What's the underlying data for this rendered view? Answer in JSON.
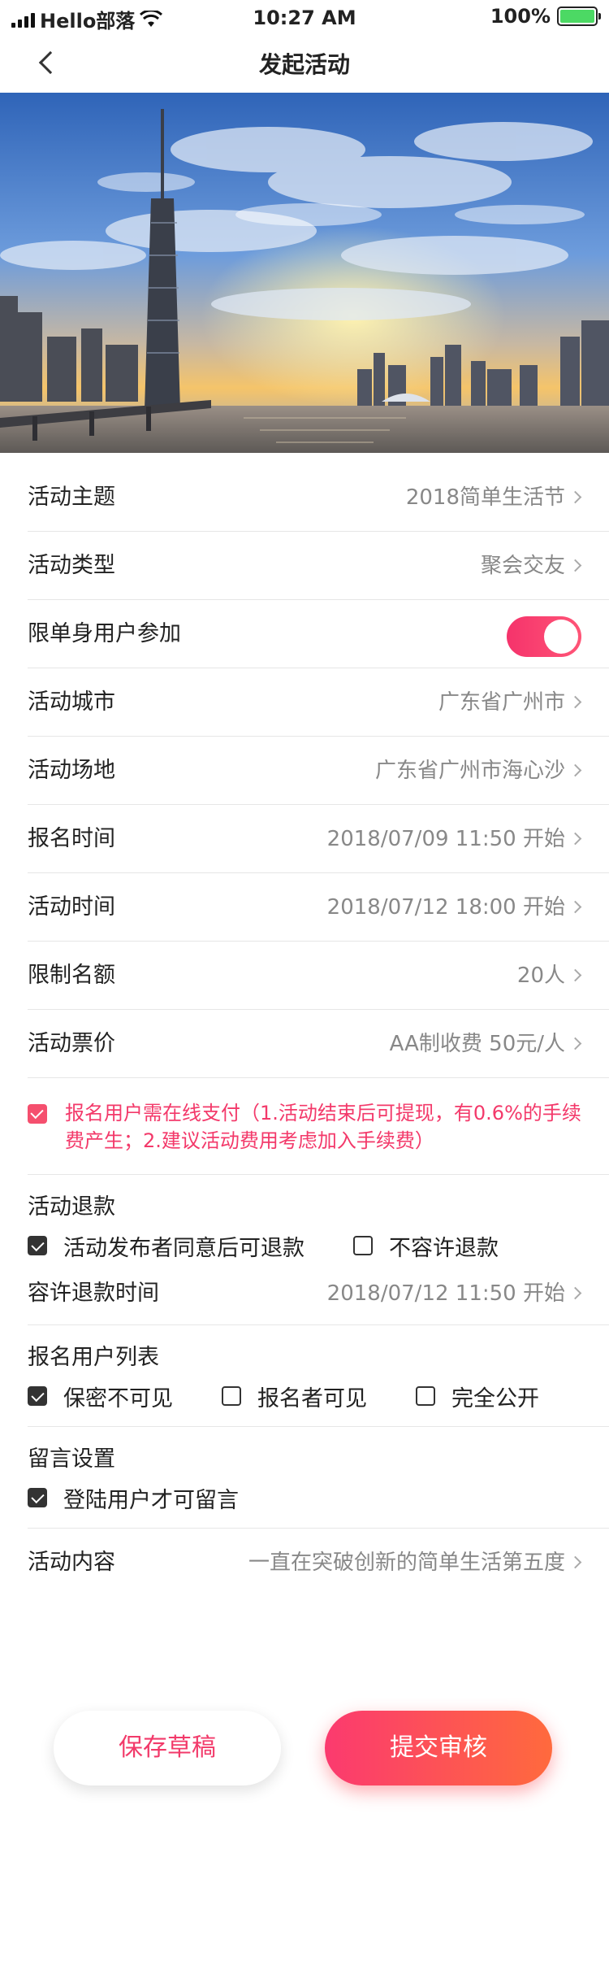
{
  "status_bar": {
    "carrier": "Hello部落",
    "time": "10:27 AM",
    "battery": "100%"
  },
  "nav": {
    "title": "发起活动"
  },
  "rows": [
    {
      "label": "活动主题",
      "value": "2018简单生活节"
    },
    {
      "label": "活动类型",
      "value": "聚会交友"
    },
    {
      "label": "限单身用户参加",
      "toggle_on": true
    },
    {
      "label": "活动城市",
      "value": "广东省广州市"
    },
    {
      "label": "活动场地",
      "value": "广东省广州市海心沙"
    },
    {
      "label": "报名时间",
      "value": "2018/07/09 11:50 开始"
    },
    {
      "label": "活动时间",
      "value": "2018/07/12 18:00 开始"
    },
    {
      "label": "限制名额",
      "value": "20人"
    },
    {
      "label": "活动票价",
      "value": "AA制收费 50元/人"
    }
  ],
  "notice": {
    "text": "报名用户需在线支付（1.活动结束后可提现，有0.6%的手续费产生；2.建议活动费用考虑加入手续费）",
    "checked": true
  },
  "refund": {
    "title": "活动退款",
    "options": [
      {
        "label": "活动发布者同意后可退款",
        "checked": true
      },
      {
        "label": "不容许退款",
        "checked": false
      }
    ],
    "time_label": "容许退款时间",
    "time_value": "2018/07/12  11:50 开始"
  },
  "signup_list": {
    "title": "报名用户列表",
    "options": [
      {
        "label": "保密不可见",
        "checked": true
      },
      {
        "label": "报名者可见",
        "checked": false
      },
      {
        "label": "完全公开",
        "checked": false
      }
    ]
  },
  "comments": {
    "title": "留言设置",
    "options": [
      {
        "label": "登陆用户才可留言",
        "checked": true
      }
    ]
  },
  "content_row": {
    "label": "活动内容",
    "value": "一直在突破创新的简单生活第五度"
  },
  "buttons": {
    "draft": "保存草稿",
    "submit": "提交审核"
  },
  "colors": {
    "accent": "#f3396a",
    "gradient_start": "#fb3a6f",
    "gradient_end": "#ff6a3d"
  }
}
